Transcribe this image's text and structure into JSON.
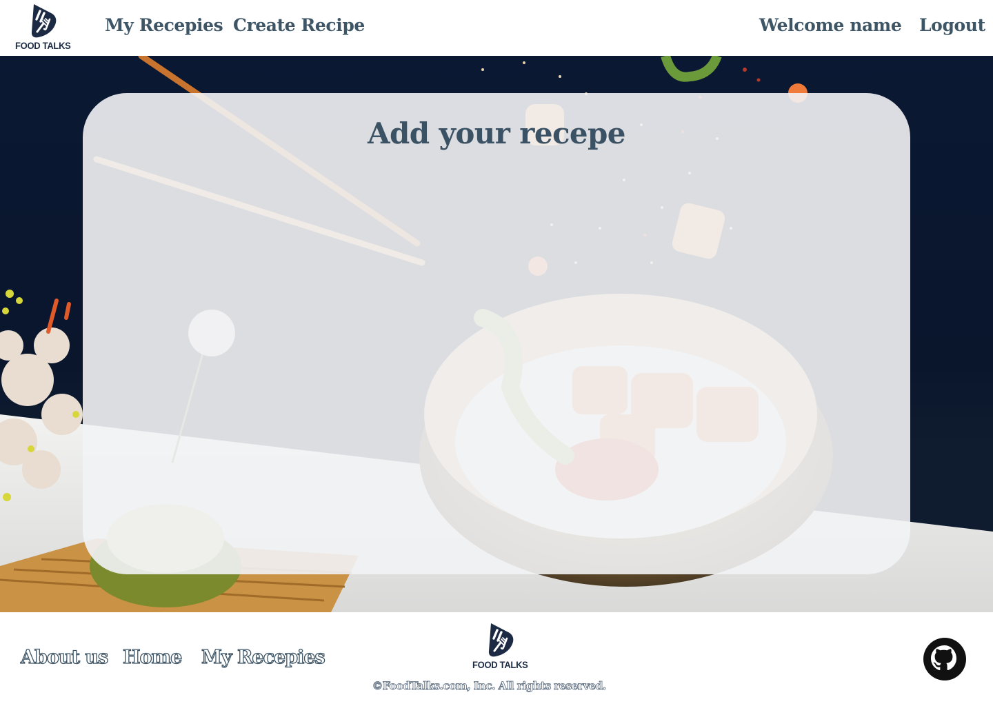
{
  "header": {
    "brand": "FOOD TALKS",
    "nav": [
      "My Recepies",
      "Create Recipe"
    ],
    "welcome": "Welcome name",
    "logout": "Logout"
  },
  "main": {
    "title": "Add your recepe"
  },
  "footer": {
    "links": [
      "About us",
      "Home",
      "My Recepies"
    ],
    "brand": "FOOD TALKS",
    "copyright": "©FoodTalks.com, Inc. All rights reserved."
  },
  "icons": {
    "logo": "food-talks-logo",
    "github": "github-icon"
  },
  "colors": {
    "nav_text": "#3e5566",
    "brand_dark": "#1c2a44",
    "hero_bg": "#0b1833"
  }
}
